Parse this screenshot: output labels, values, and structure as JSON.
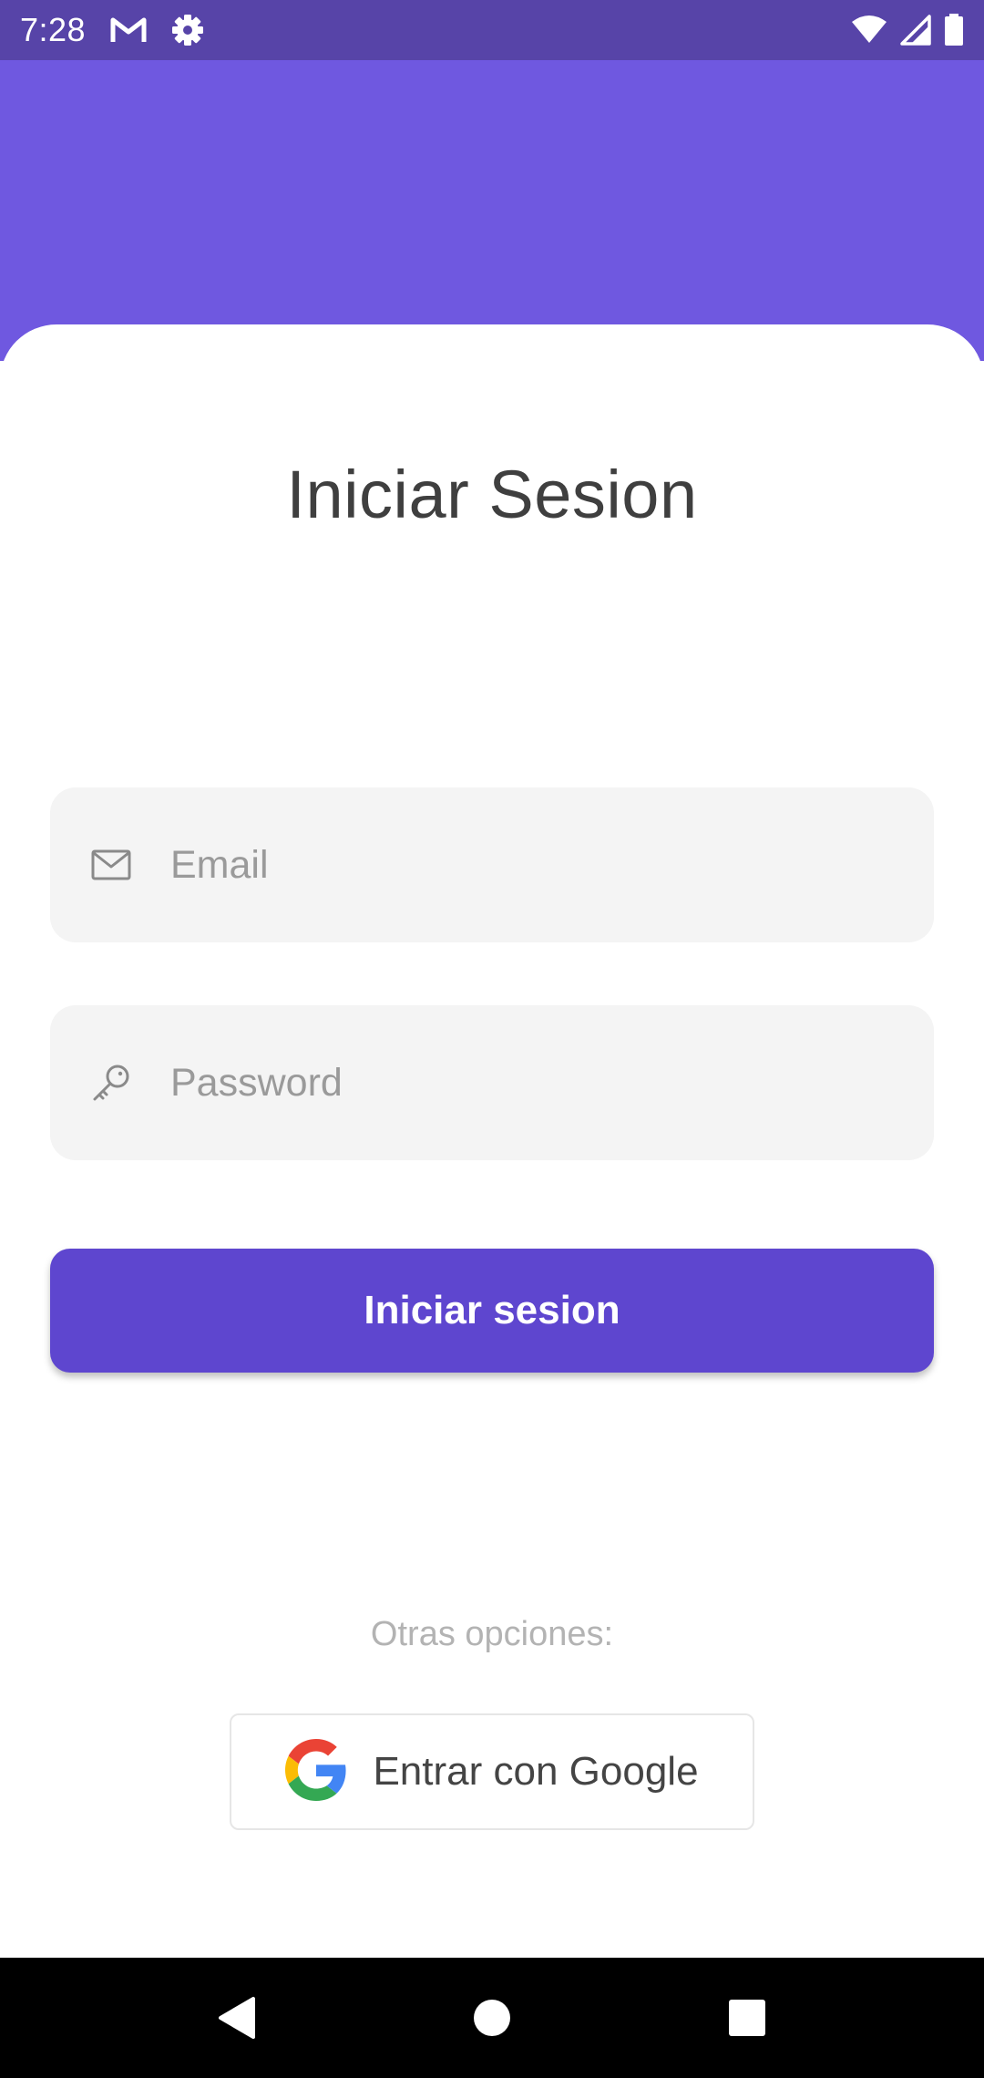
{
  "status_bar": {
    "time": "7:28",
    "left_icons": [
      "gmail-icon",
      "settings-icon"
    ],
    "right_icons": [
      "wifi-icon",
      "cell-signal-icon",
      "battery-icon"
    ]
  },
  "colors": {
    "status_bar": "#5744a8",
    "header": "#6f58e0",
    "primary_button": "#5e46cf",
    "field_background": "#f4f4f4"
  },
  "login": {
    "title": "Iniciar Sesion",
    "email": {
      "placeholder": "Email",
      "value": "",
      "icon": "mail-icon"
    },
    "password": {
      "placeholder": "Password",
      "value": "",
      "icon": "key-icon"
    },
    "submit_label": "Iniciar sesion",
    "other_options_label": "Otras opciones:",
    "google_label": "Entrar con Google"
  },
  "nav_bar": {
    "buttons": [
      "back-icon",
      "home-icon",
      "recents-icon"
    ]
  }
}
